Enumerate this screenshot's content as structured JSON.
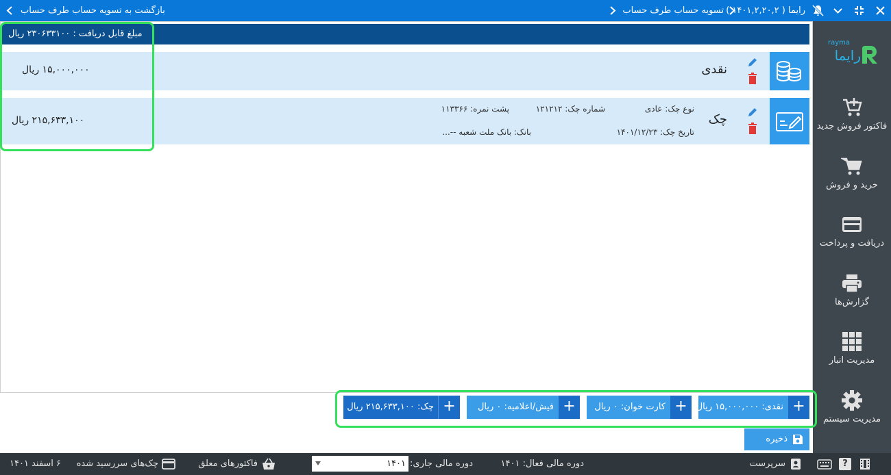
{
  "topbar": {
    "nav_title": "تسویه حساب طرف حساب",
    "app_name": "رایما ( ۱۴۰۱,۲,۲۰,۲ )",
    "back_text": "بازگشت به تسویه حساب طرف حساب"
  },
  "summary": {
    "amount_label": "مبلغ قابل دریافت : ۲۳۰۶۳۳۱۰۰ ریال"
  },
  "rows": [
    {
      "type": "نقدی",
      "amount": "۱۵,۰۰۰,۰۰۰ ریال"
    },
    {
      "type": "چک",
      "amount": "۲۱۵,۶۳۳,۱۰۰ ریال",
      "check_kind": "نوع چک: عادی",
      "check_number": "شماره چک: ۱۲۱۲۱۲",
      "serial": "پشت نمره: ۱۱۳۳۶۶",
      "check_date": "تاریخ چک: ۱۴۰۱/۱۲/۲۳",
      "bank": "بانک: بانک ملت شعبه --..."
    }
  ],
  "payment_buttons": {
    "cash": "نقدی: ۱۵,۰۰۰,۰۰۰ ریال",
    "card": "کارت خوان: ۰ ریال",
    "slip": "فیش/اعلامیه: ۰ ریال",
    "check": "چک: ۲۱۵,۶۳۳,۱۰۰ ریال"
  },
  "save_label": "ذخیره",
  "sidebar": {
    "logo_latin": "rayma",
    "logo_persian": "رایما",
    "items": [
      {
        "label": "فاکتور فروش جدید",
        "icon": "cart-plus-icon"
      },
      {
        "label": "خرید و فروش",
        "icon": "cart-icon"
      },
      {
        "label": "دریافت و پرداخت",
        "icon": "credit-card-icon"
      },
      {
        "label": "گزارش‌ها",
        "icon": "printer-icon"
      },
      {
        "label": "مدیریت انبار",
        "icon": "grid-icon"
      },
      {
        "label": "مدیریت سیستم",
        "icon": "gear-icon"
      }
    ]
  },
  "statusbar": {
    "user": "سرپرست",
    "active_period": "دوره مالی فعال: ۱۴۰۱",
    "current_period_label": "دوره مالی جاری:",
    "current_period_value": "۱۴۰۱",
    "open_invoices": "فاکتورهای معلق",
    "due_checks": "چک‌های سررسید شده",
    "date": "۶ اسفند ۱۴۰۱"
  },
  "colors": {
    "topbar": "#0a78d8",
    "sidebar": "#3e464e",
    "statusbar": "#2f363c",
    "header": "#0b4f8e",
    "row_bg": "#d7eaf9",
    "accent": "#2f9bea",
    "highlight": "#35e05c",
    "delete": "#e53935"
  }
}
